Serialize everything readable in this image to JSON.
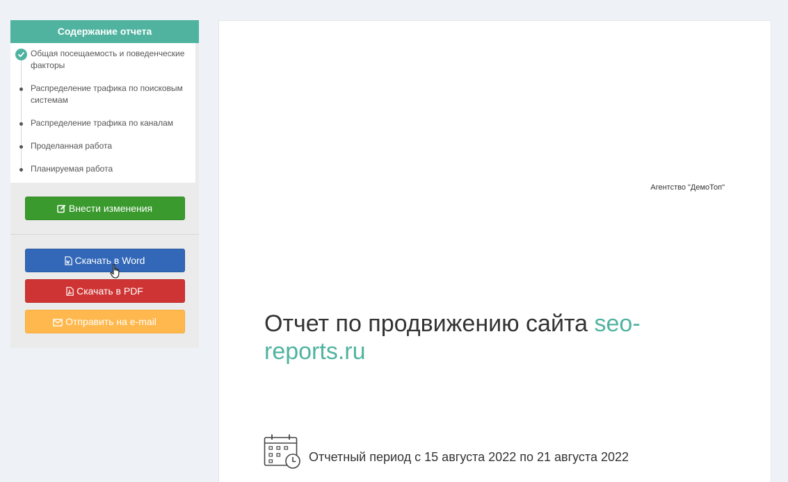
{
  "sidebar": {
    "toc_title": "Содержание отчета",
    "toc_items": [
      {
        "label": "Общая посещаемость и поведенческие факторы",
        "active": true
      },
      {
        "label": "Распределение трафика по поисковым системам",
        "active": false
      },
      {
        "label": "Распределение трафика по каналам",
        "active": false
      },
      {
        "label": "Проделанная работа",
        "active": false
      },
      {
        "label": "Планируемая работа",
        "active": false
      }
    ],
    "edit_button": "Внести изменения",
    "word_button": "Скачать в Word",
    "pdf_button": "Скачать в PDF",
    "email_button": "Отправить на e-mail"
  },
  "report": {
    "agency": "Агентство \"ДемоТоп\"",
    "title_prefix": "Отчет по продвижению сайта ",
    "site": "seo-reports.ru",
    "period": "Отчетный период с 15 августа 2022 по 21 августа 2022"
  },
  "colors": {
    "accent": "#4fb3a0",
    "green": "#3a9a2e",
    "blue": "#3368b8",
    "red": "#cf3434",
    "orange": "#ffb84d"
  },
  "icons": {
    "edit": "edit-icon",
    "word": "file-word-icon",
    "pdf": "file-pdf-icon",
    "email": "envelope-icon",
    "calendar": "calendar-clock-icon",
    "check": "check-icon"
  }
}
